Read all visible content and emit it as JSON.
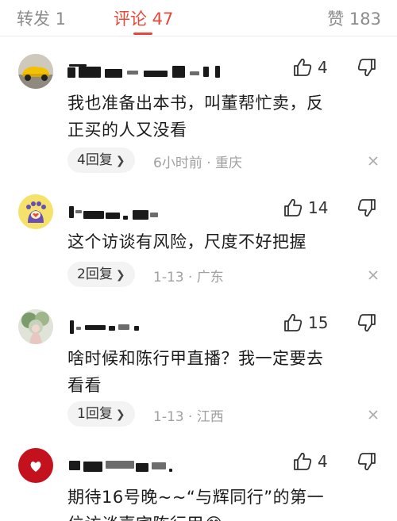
{
  "tabs": {
    "repost": "转发 1",
    "comments": "评论 47",
    "likes": "赞 183"
  },
  "comments": [
    {
      "likes": "4",
      "text_lines": [
        "我也准备出本书，叫董帮忙卖，反",
        "正买的人又没看"
      ],
      "reply_label": "4回复",
      "meta": "6小时前 · 重庆"
    },
    {
      "likes": "14",
      "text_lines": [
        "这个访谈有风险，尺度不好把握"
      ],
      "reply_label": "2回复",
      "meta": "1-13 · 广东"
    },
    {
      "likes": "15",
      "text_lines": [
        "啥时候和陈行甲直播？我一定要去",
        "看看"
      ],
      "reply_label": "1回复",
      "meta": "1-13 · 江西"
    },
    {
      "likes": "4",
      "text_lines": [
        "期待16号晚~~“与辉同行”的第一",
        "位访谈嘉宾陈行甲😂"
      ]
    }
  ],
  "icons": {
    "thumb": "thumbs-up-icon",
    "dislike": "thumbs-down-icon",
    "close": "close-icon",
    "chevron": "chevron-right-icon"
  },
  "colors": {
    "accent": "#e8473a",
    "meta_gray": "#a0a0a0"
  }
}
